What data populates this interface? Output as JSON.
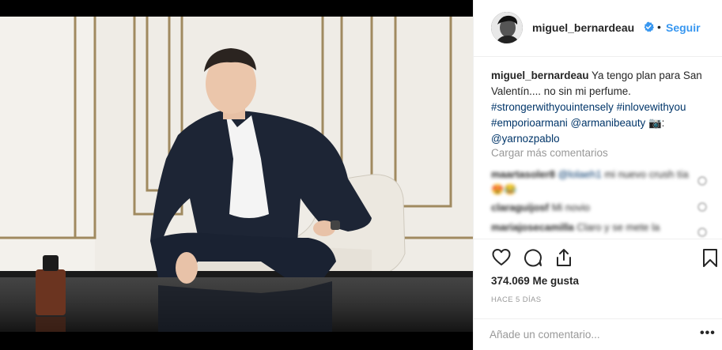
{
  "post": {
    "username": "miguel_bernardeau",
    "follow_label": "Seguir",
    "separator": "•",
    "caption": {
      "user": "miguel_bernardeau",
      "text1": "Ya tengo plan para San Valentín.... no sin mi perfume.",
      "tag1": "#strongerwithyouintensely",
      "tag2": "#inlovewithyou",
      "tag3": "#emporioarmani",
      "tag4": "@armanibeauty",
      "emoji": "📷",
      "colon": ":",
      "tag5": "@yarnozpablo"
    },
    "load_more_label": "Cargar más comentarios",
    "comments": [
      {
        "user": "maartasoler8",
        "mention": "@lolaeh1",
        "text": "mi nuevo crush tía 😍😂"
      },
      {
        "user": "claraguijosf",
        "mention": "",
        "text": "Mi novio"
      },
      {
        "user": "mariajosecamilla",
        "mention": "",
        "text": "Claro y se mete la"
      }
    ],
    "likes": "374.069 Me gusta",
    "time_ago": "HACE 5 DÍAS",
    "add_comment_placeholder": "Añade un comentario...",
    "more_options": "•••"
  },
  "icons": {
    "verified": "verified-badge-icon",
    "like": "heart-icon",
    "comment": "comment-bubble-icon",
    "share": "share-icon",
    "save": "bookmark-icon"
  },
  "colors": {
    "accent_blue": "#3897f0",
    "hashtag": "#003569",
    "muted": "#999999",
    "border": "#efefef"
  }
}
